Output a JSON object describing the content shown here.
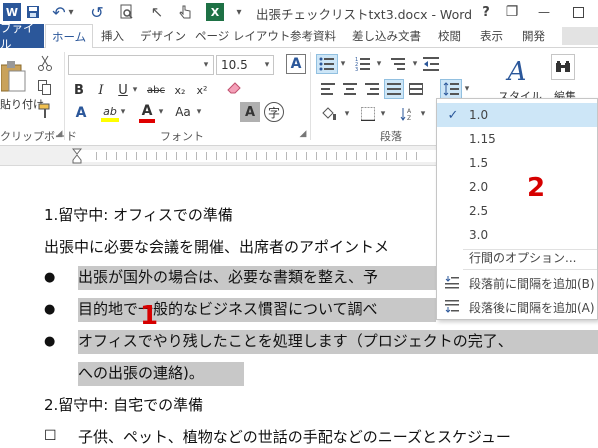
{
  "window": {
    "title": "出張チェックリストtxt3.docx - Word",
    "help": "?",
    "restore": "❐",
    "minimize": "—",
    "close": "✕"
  },
  "qat": {
    "word_logo": "W",
    "save": "💾",
    "undo": "↶",
    "undo_drop": "▾",
    "redo": "↺",
    "preview": "🔍",
    "pointer": "↖",
    "excel": "X",
    "more": "▾"
  },
  "tabs": [
    "ファイル",
    "ホーム",
    "挿入",
    "デザイン",
    "ページ レイアウト",
    "参考資料",
    "差し込み文書",
    "校閲",
    "表示",
    "開発"
  ],
  "ribbon": {
    "clipboard": {
      "paste_label": "貼り付け",
      "group_label": "クリップボード"
    },
    "font": {
      "font_name": "",
      "font_size": "10.5",
      "size_drop": "▾",
      "grow": "A",
      "bold": "B",
      "italic": "I",
      "underline": "U",
      "strike": "abc",
      "subscript": "x₂",
      "superscript": "x²",
      "highlight": "ab",
      "font_color": "A",
      "case": "Aa",
      "shade": "A",
      "enclose": "字",
      "group_label": "フォント"
    },
    "paragraph": {
      "group_label": "段落"
    },
    "styles": {
      "label": "スタイル"
    },
    "edit": {
      "label": "編集"
    }
  },
  "document": {
    "heading1": "1.留守中: オフィスでの準備",
    "intro": "出張中に必要な会議を開催、出席者のアポイントメ",
    "bullet1": "出張が国外の場合は、必要な書類を整え、予",
    "bullet2": "目的地で一般的なビジネス慣習について調べ",
    "bullet3a": "オフィスでやり残したことを処理します（プロジェクトの完了、",
    "bullet3b": "への出張の連絡)。",
    "heading2": "2.留守中: 自宅での準備",
    "bullet4": "子供、ペット、植物などの世話の手配などのニーズとスケジュー",
    "bullet_char": "●",
    "square_char": "☐"
  },
  "line_spacing_menu": {
    "items": [
      "1.0",
      "1.15",
      "1.5",
      "2.0",
      "2.5",
      "3.0"
    ],
    "selected": "1.0",
    "options": "行間のオプション...",
    "add_before": "段落前に間隔を追加(B)",
    "add_after": "段落後に間隔を追加(A)",
    "check": "✓"
  },
  "annotations": {
    "mark1": "1",
    "mark2": "2"
  }
}
